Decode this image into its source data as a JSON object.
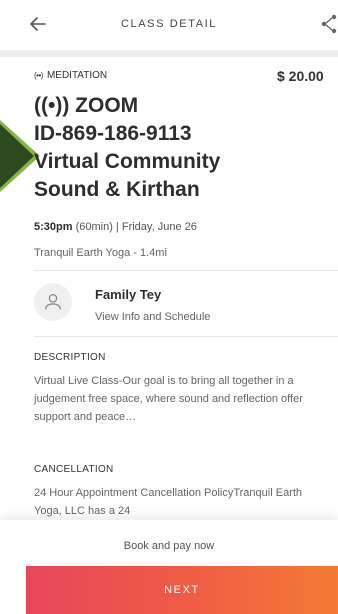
{
  "header": {
    "title": "CLASS DETAIL",
    "back_icon": "arrow-left-icon",
    "share_icon": "share-icon"
  },
  "class": {
    "live_glyph": "(••)",
    "category": "MEDITATION",
    "price": "$ 20.00",
    "title_lines": [
      "((•)) ZOOM",
      "ID-869-186-9113",
      "Virtual Community",
      "Sound & Kirthan"
    ],
    "time": "5:30pm",
    "duration_date": "(60min) | Friday, June 26",
    "studio": "Tranquil Earth Yoga - 1.4mi"
  },
  "instructor": {
    "name": "Family Tey",
    "link_label": "View Info and Schedule",
    "avatar_icon": "user-avatar-icon"
  },
  "description": {
    "label": "DESCRIPTION",
    "text": "Virtual Live Class-Our goal is to bring all together in a judgement free space, where sound and reflection offer support and peace…"
  },
  "cancellation": {
    "label": "CANCELLATION",
    "text": "24 Hour Appointment Cancellation PolicyTranquil Earth Yoga, LLC has a 24"
  },
  "footer": {
    "book_label": "Book and pay now",
    "next_label": "NEXT"
  },
  "colors": {
    "accent_start": "#e8465b",
    "accent_end": "#f47a34",
    "tab_green": "#86b544"
  }
}
